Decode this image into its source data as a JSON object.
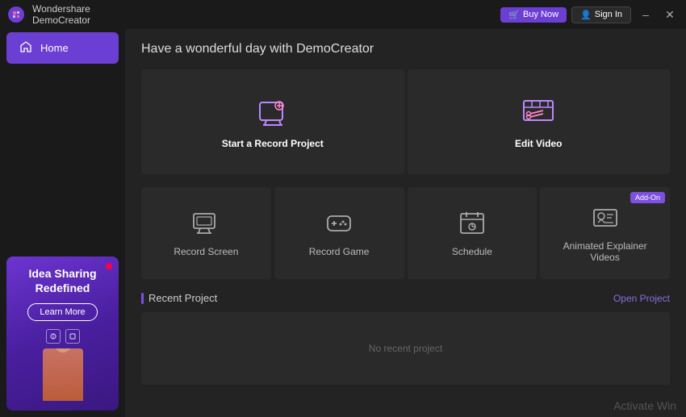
{
  "app": {
    "name_line1": "Wondershare",
    "name_line2": "DemoCreator"
  },
  "titlebar": {
    "buy_now": "Buy Now",
    "sign_in": "Sign In",
    "minimize": "–",
    "close": "✕"
  },
  "sidebar": {
    "items": [
      {
        "id": "home",
        "label": "Home",
        "active": true
      }
    ],
    "promo": {
      "title": "Idea Sharing Redefined",
      "button": "Learn More"
    }
  },
  "header": {
    "greeting": "Have a wonderful day with DemoCreator"
  },
  "cards_top": [
    {
      "id": "record-project",
      "label": "Start a Record Project",
      "highlighted": true
    },
    {
      "id": "edit-video",
      "label": "Edit Video",
      "highlighted": true
    }
  ],
  "cards_bottom": [
    {
      "id": "record-screen",
      "label": "Record Screen",
      "addon": false
    },
    {
      "id": "record-game",
      "label": "Record Game",
      "addon": false
    },
    {
      "id": "schedule",
      "label": "Schedule",
      "addon": false
    },
    {
      "id": "animated-explainer",
      "label": "Animated Explainer Videos",
      "addon": true,
      "addon_label": "Add-On"
    }
  ],
  "recent": {
    "title": "Recent Project",
    "open_link": "Open Project",
    "empty_text": "No recent project"
  },
  "activate": {
    "text": "Activate Win"
  }
}
